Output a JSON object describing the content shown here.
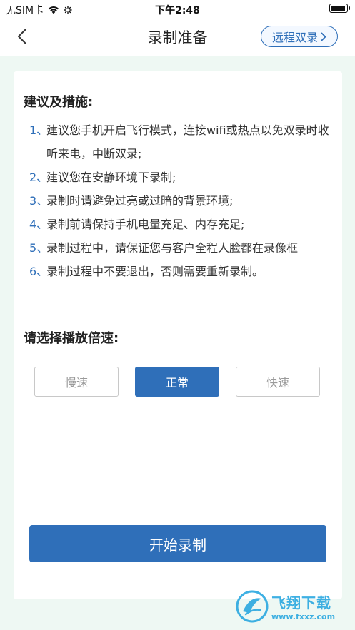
{
  "status_bar": {
    "carrier": "无SIM卡",
    "time": "下午2:48"
  },
  "nav": {
    "title": "录制准备",
    "remote_label": "远程双录"
  },
  "advice": {
    "title": "建议及措施:",
    "items": [
      {
        "num": "1、",
        "text": "建议您手机开启飞行模式，连接wifi或热点以免双录时收听来电，中断双录;"
      },
      {
        "num": "2、",
        "text": "建议您在安静环境下录制;"
      },
      {
        "num": "3、",
        "text": "录制时请避免过亮或过暗的背景环境;"
      },
      {
        "num": "4、",
        "text": "录制前请保持手机电量充足、内存充足;"
      },
      {
        "num": "5、",
        "text": "录制过程中，请保证您与客户全程人脸都在录像框"
      },
      {
        "num": "6、",
        "text": "录制过程中不要退出，否则需要重新录制。"
      }
    ]
  },
  "speed": {
    "title": "请选择播放倍速:",
    "options": [
      "慢速",
      "正常",
      "快速"
    ],
    "selected": "正常"
  },
  "start_label": "开始录制",
  "watermark": {
    "name": "飞翔下载",
    "url": "www.fxxz.com"
  },
  "colors": {
    "accent": "#2f6fb9",
    "background": "#eef8f3"
  }
}
